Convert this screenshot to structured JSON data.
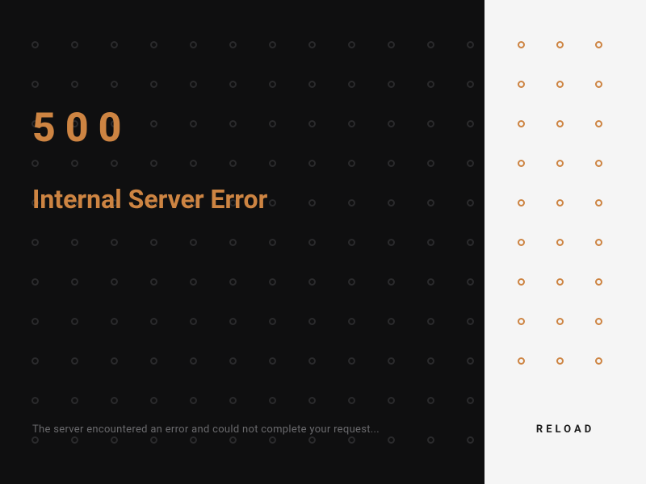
{
  "error": {
    "code": "500",
    "title": "Internal Server Error",
    "message": "The server encountered an error and could not complete your request..."
  },
  "actions": {
    "reload": "RELOAD"
  },
  "colors": {
    "accent": "#cd8442",
    "darkBg": "#0f0f10",
    "lightBg": "#f5f5f5"
  }
}
